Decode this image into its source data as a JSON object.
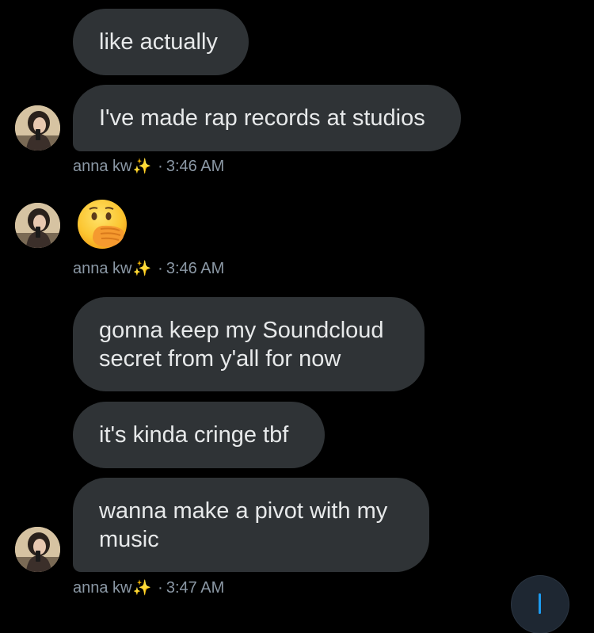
{
  "colors": {
    "background": "#000000",
    "bubble": "#2f3336",
    "text": "#e7e9ea",
    "meta": "#8b98a5",
    "accent": "#1d9bf0"
  },
  "messages": [
    {
      "text": "like actually"
    },
    {
      "text": "I've made rap records at studios"
    },
    {
      "text": "gonna keep my Soundcloud secret from y'all for now"
    },
    {
      "text": "it's kinda cringe tbf"
    },
    {
      "text": "wanna make a pivot with my music"
    }
  ],
  "emoji_message": {
    "icon": "hand-over-mouth-emoji"
  },
  "meta": [
    {
      "sender": "anna kw",
      "sparkle": "✨",
      "separator": "·",
      "time": "3:46 AM"
    },
    {
      "sender": "anna kw",
      "sparkle": "✨",
      "separator": "·",
      "time": "3:46 AM"
    },
    {
      "sender": "anna kw",
      "sparkle": "✨",
      "separator": "·",
      "time": "3:47 AM"
    }
  ],
  "scroll_button": {
    "icon": "arrow-down-icon"
  }
}
